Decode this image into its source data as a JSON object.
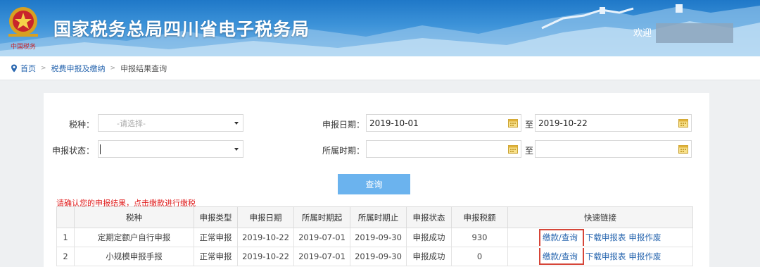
{
  "header": {
    "site_title": "国家税务总局四川省电子税务局",
    "welcome": "欢迎"
  },
  "breadcrumb": {
    "home": "首页",
    "level2": "税费申报及缴纳",
    "current": "申报结果查询"
  },
  "form": {
    "tax_type_label": "税种：",
    "tax_type_placeholder": "-请选择-",
    "status_label": "申报状态：",
    "status_value": "",
    "date_label": "申报日期：",
    "date_from": "2019-10-01",
    "date_to": "2019-10-22",
    "to_label": "至",
    "period_label": "所属时期：",
    "period_from": "",
    "period_to": "",
    "query_button": "查询"
  },
  "notice": "请确认您的申报结果，点击缴款进行缴税",
  "table": {
    "columns": [
      "",
      "税种",
      "申报类型",
      "申报日期",
      "所属时期起",
      "所属时期止",
      "申报状态",
      "申报税额",
      "快速链接"
    ],
    "rows": [
      {
        "index": "1",
        "tax": "定期定额户自行申报",
        "type": "正常申报",
        "date": "2019-10-22",
        "start": "2019-07-01",
        "end": "2019-09-30",
        "status": "申报成功",
        "amount": "930",
        "pay": "缴款/查询",
        "download": "下载申报表",
        "void": "申报作废"
      },
      {
        "index": "2",
        "tax": "小规模申报手报",
        "type": "正常申报",
        "date": "2019-10-22",
        "start": "2019-07-01",
        "end": "2019-09-30",
        "status": "申报成功",
        "amount": "0",
        "pay": "缴款/查询",
        "download": "下载申报表",
        "void": "申报作废"
      }
    ]
  },
  "colors": {
    "header_blue": "#1f78c8",
    "link_blue": "#2b68b0",
    "button_blue": "#6bb3ee",
    "notice_red": "#e02020",
    "highlight_red": "#d64538"
  },
  "icons": [
    "tax-emblem-icon",
    "location-pin-icon",
    "chevron-right-icon",
    "dropdown-arrow-icon",
    "calendar-icon"
  ]
}
